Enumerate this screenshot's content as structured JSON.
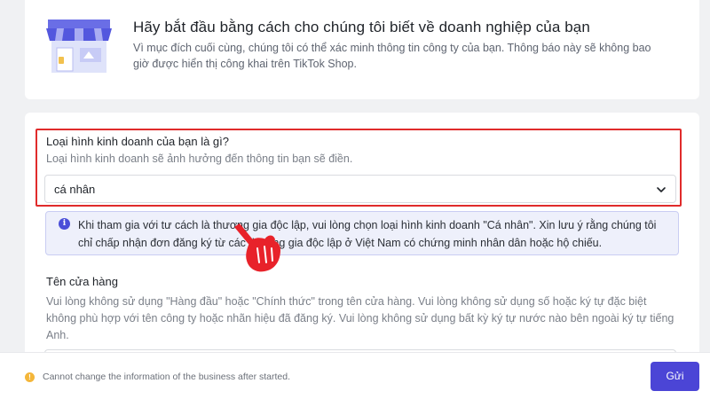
{
  "intro": {
    "title": "Hãy bắt đầu bằng cách cho chúng tôi biết về doanh nghiệp của bạn",
    "description": "Vì mục đích cuối cùng, chúng tôi có thể xác minh thông tin công ty của bạn. Thông báo này sẽ không bao giờ được hiển thị công khai trên TikTok Shop."
  },
  "business_type": {
    "label": "Loại hình kinh doanh của bạn là gì?",
    "hint": "Loại hình kinh doanh sẽ ảnh hưởng đến thông tin bạn sẽ điền.",
    "selected_value": "cá nhân",
    "icon": "chevron-down-icon"
  },
  "notice": {
    "icon": "info-icon",
    "text": "Khi tham gia với tư cách là thương gia độc lập, vui lòng chọn loại hình kinh doanh \"Cá nhân\". Xin lưu ý rằng chúng tôi chỉ chấp nhận đơn đăng ký từ các thương gia độc lập ở Việt Nam có chứng minh nhân dân hoặc hộ chiếu."
  },
  "store_name": {
    "label": "Tên cửa hàng",
    "hint": "Vui lòng không sử dụng \"Hàng đầu\" hoặc \"Chính thức\" trong tên cửa hàng. Vui lòng không sử dụng số hoặc ký tự đặc biệt không phù hợp với tên công ty hoặc nhãn hiệu đã đăng ký. Vui lòng không sử dụng bất kỳ ký tự nước nào bên ngoài ký tự tiếng Anh."
  },
  "footer": {
    "icon": "warning-icon",
    "warning_text": "Cannot change the information of the business after started.",
    "submit_label": "Gửi"
  },
  "colors": {
    "accent": "#4b45d6",
    "highlight": "#e02b2b",
    "pointer": "#e8222a",
    "warning": "#f4b63a"
  }
}
